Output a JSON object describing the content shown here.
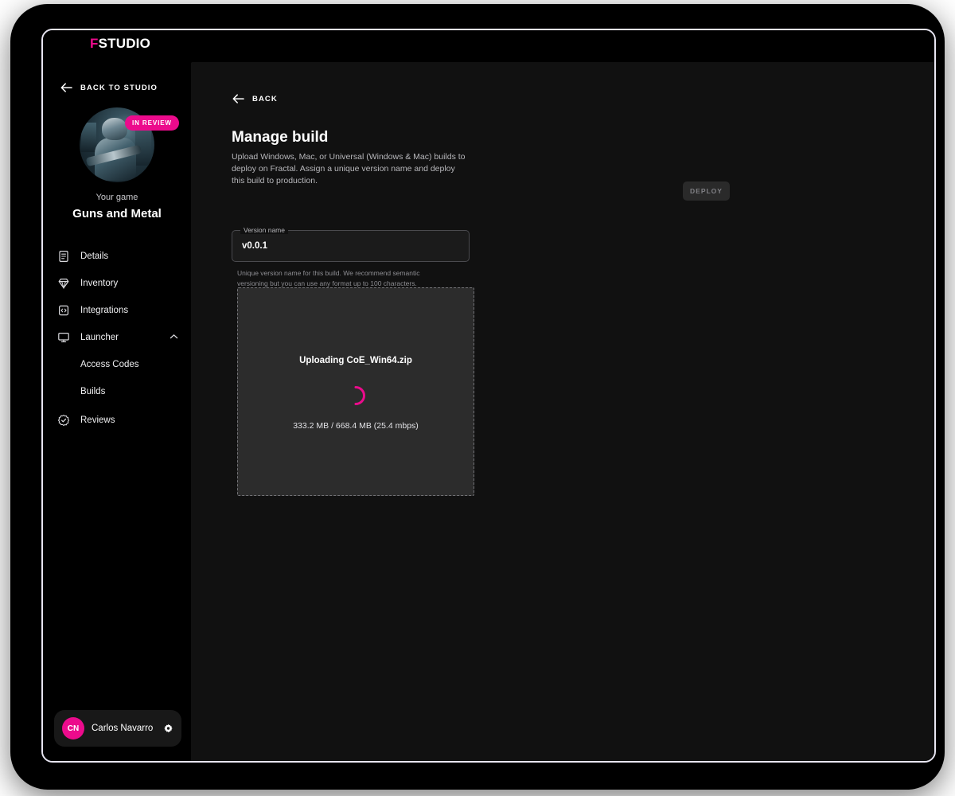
{
  "brand": {
    "accent_letter": "F",
    "rest": "STUDIO",
    "accent_color": "#ec0b8c"
  },
  "sidebar": {
    "back_to_studio": {
      "label": "BACK TO STUDIO",
      "icon": "arrow-left-icon"
    },
    "game": {
      "badge": "IN REVIEW",
      "caption": "Your game",
      "title": "Guns and Metal"
    },
    "nav_items": [
      {
        "label": "Details",
        "icon": "document-icon",
        "expandable": false
      },
      {
        "label": "Inventory",
        "icon": "gem-icon",
        "expandable": false
      },
      {
        "label": "Integrations",
        "icon": "code-box-icon",
        "expandable": false
      },
      {
        "label": "Launcher",
        "icon": "monitor-icon",
        "expandable": true,
        "expanded": true,
        "chevron": "chevron-up-icon"
      },
      {
        "label": "Reviews",
        "icon": "verified-badge-icon",
        "expandable": false
      }
    ],
    "nav_sub_items": [
      {
        "label": "Access Codes",
        "parent": "Launcher"
      },
      {
        "label": "Builds",
        "parent": "Launcher"
      }
    ],
    "user": {
      "initials": "CN",
      "name": "Carlos Navarro",
      "settings_icon": "gear-icon",
      "avatar_color": "#ec0b8c"
    }
  },
  "main": {
    "back": {
      "label": "BACK",
      "icon": "arrow-left-icon"
    },
    "title": "Manage build",
    "description": "Upload Windows, Mac, or Universal (Windows & Mac) builds to deploy on Fractal. Assign a unique version name and deploy this build to production.",
    "deploy_button": {
      "label": "DEPLOY",
      "disabled": true
    },
    "version_field": {
      "legend": "Version name",
      "value": "v0.0.1",
      "placeholder": "",
      "helper_text": "Unique version name for this build. We recommend semantic versioning but you can use any format up to 100 characters."
    },
    "dropzone": {
      "status_text": "Uploading CoE_Win64.zip",
      "progress_text": "333.2 MB / 668.4 MB (25.4 mbps)",
      "spinner_color": "#ec0b8c",
      "uploaded_mb": 333.2,
      "total_mb": 668.4,
      "speed_mbps": 25.4,
      "filename": "CoE_Win64.zip"
    }
  }
}
